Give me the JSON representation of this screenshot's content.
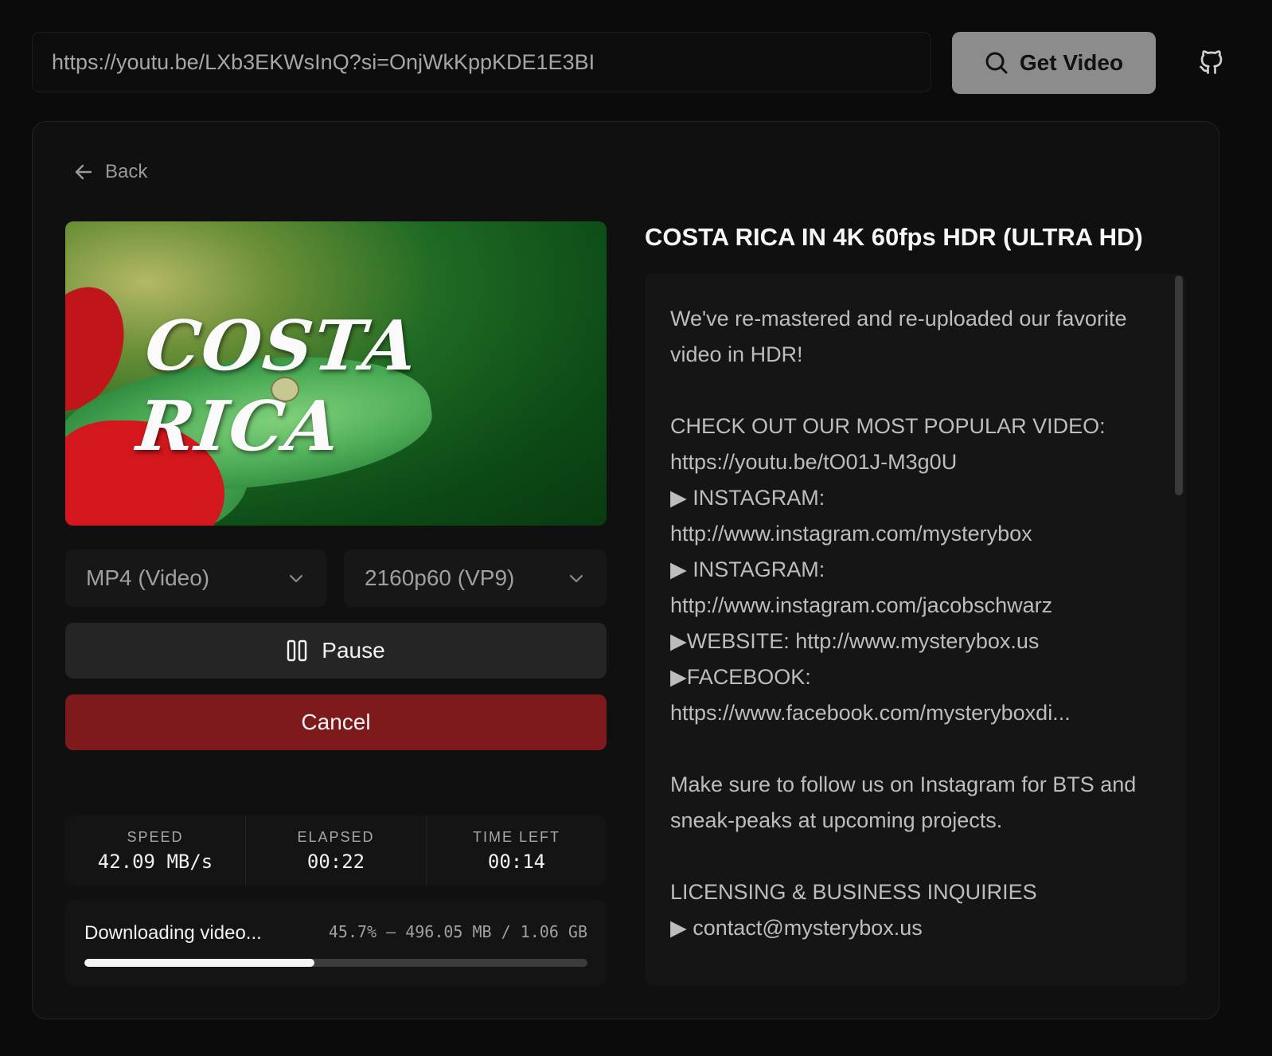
{
  "search": {
    "url_value": "https://youtu.be/LXb3EKWsInQ?si=OnjWkKppKDE1E3BI"
  },
  "get_video_label": "Get Video",
  "back_label": "Back",
  "thumbnail": {
    "overlay_text": "COSTA RICA"
  },
  "format_select": {
    "selected": "MP4 (Video)"
  },
  "quality_select": {
    "selected": "2160p60 (VP9)"
  },
  "pause_label": "Pause",
  "cancel_label": "Cancel",
  "stats": {
    "speed": {
      "label": "SPEED",
      "value": "42.09 MB/s"
    },
    "elapsed": {
      "label": "ELAPSED",
      "value": "00:22"
    },
    "time_left": {
      "label": "TIME LEFT",
      "value": "00:14"
    }
  },
  "progress": {
    "status": "Downloading video...",
    "detail": "45.7% — 496.05 MB / 1.06 GB",
    "percent": 45.7
  },
  "video": {
    "title": "COSTA RICA IN 4K 60fps HDR (ULTRA HD)",
    "description": "We've re-mastered and re-uploaded our favorite video in HDR!\n\nCHECK OUT OUR MOST POPULAR VIDEO: https://youtu.be/tO01J-M3g0U\n▶ INSTAGRAM: http://www.instagram.com/mysterybox\n▶ INSTAGRAM: http://www.instagram.com/jacobschwarz\n▶WEBSITE: http://www.mysterybox.us\n▶FACEBOOK: https://www.facebook.com/mysteryboxdi...\n\nMake sure to follow us on Instagram for BTS and sneak-peaks at upcoming projects.\n\nLICENSING & BUSINESS INQUIRIES\n▶ contact@mysterybox.us"
  },
  "icons": {
    "search": "search-icon",
    "github": "github-icon",
    "back": "arrow-left-icon",
    "chevron": "chevron-down-icon",
    "pause": "pause-icon"
  },
  "colors": {
    "background": "#0b0b0b",
    "get_video_button": "#8c8c8c",
    "cancel_button": "#7e1a1c",
    "progress_fill": "#f5f5f5"
  }
}
